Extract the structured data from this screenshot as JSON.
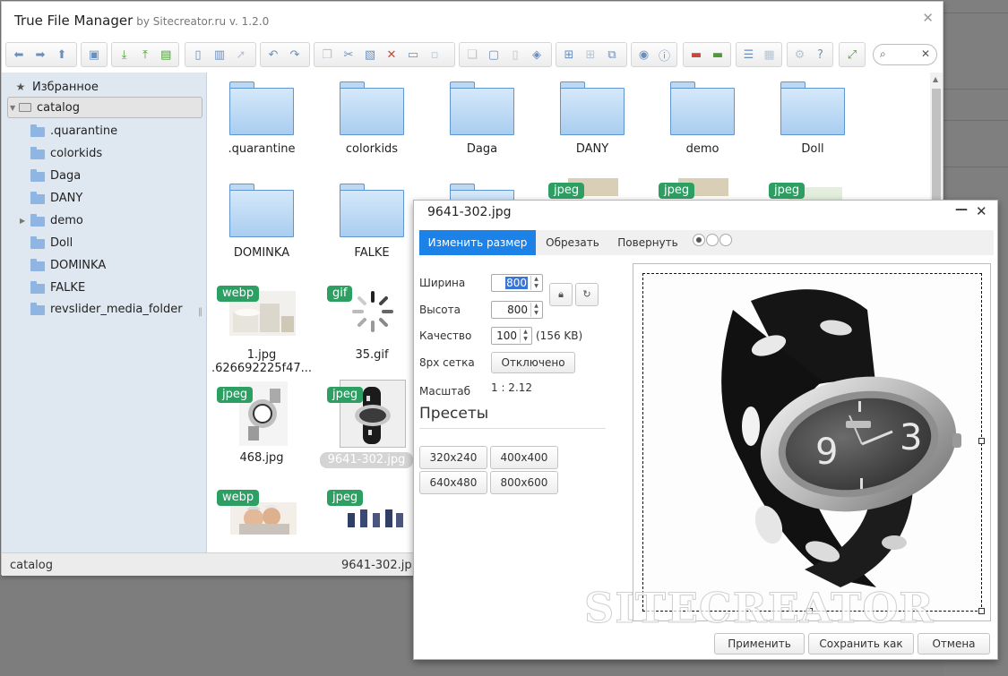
{
  "window": {
    "title": "True File Manager",
    "subtitle": "by Sitecreator.ru v. 1.2.0"
  },
  "toolbar": {
    "search_placeholder": ""
  },
  "sidebar": {
    "favorites_label": "Избранное",
    "root_label": "catalog",
    "folders": [
      ".quarantine",
      "colorkids",
      "Daga",
      "DANY",
      "demo",
      "Doll",
      "DOMINKA",
      "FALKE",
      "revslider_media_folder"
    ]
  },
  "content": {
    "folders": [
      ".quarantine",
      "colorkids",
      "Daga",
      "DANY",
      "demo",
      "Doll",
      "DOMINKA",
      "FALKE"
    ],
    "files": [
      {
        "name": "1.jpg",
        "subname": ".626692225f47...",
        "badge": "webp"
      },
      {
        "name": "35.gif",
        "badge": "gif"
      },
      {
        "name": "468.jpg",
        "badge": "jpeg"
      },
      {
        "name": "9641-302.jpg",
        "badge": "jpeg"
      },
      {
        "name": "",
        "badge": "webp"
      },
      {
        "name": "",
        "badge": "jpeg"
      }
    ],
    "partial_badges": [
      "jpeg",
      "jpeg",
      "jpeg"
    ]
  },
  "statusbar": {
    "left": "catalog",
    "right": "9641-302.jp"
  },
  "dialog": {
    "title": "9641-302.jpg",
    "tabs": [
      "Изменить размер",
      "Обрезать",
      "Повернуть"
    ],
    "form": {
      "width_label": "Ширина",
      "width_value": "800",
      "height_label": "Высота",
      "height_value": "800",
      "quality_label": "Качество",
      "quality_value": "100",
      "quality_size": "(156 KB)",
      "grid_label": "8px сетка",
      "grid_button": "Отключено",
      "scale_label": "Масштаб",
      "scale_value": "1 : 2.12"
    },
    "presets_title": "Пресеты",
    "presets": [
      "320x240",
      "400x400",
      "640x480",
      "800x600"
    ],
    "buttons": {
      "apply": "Применить",
      "save_as": "Сохранить как",
      "cancel": "Отмена"
    },
    "watermark": "SITECREATOR"
  }
}
